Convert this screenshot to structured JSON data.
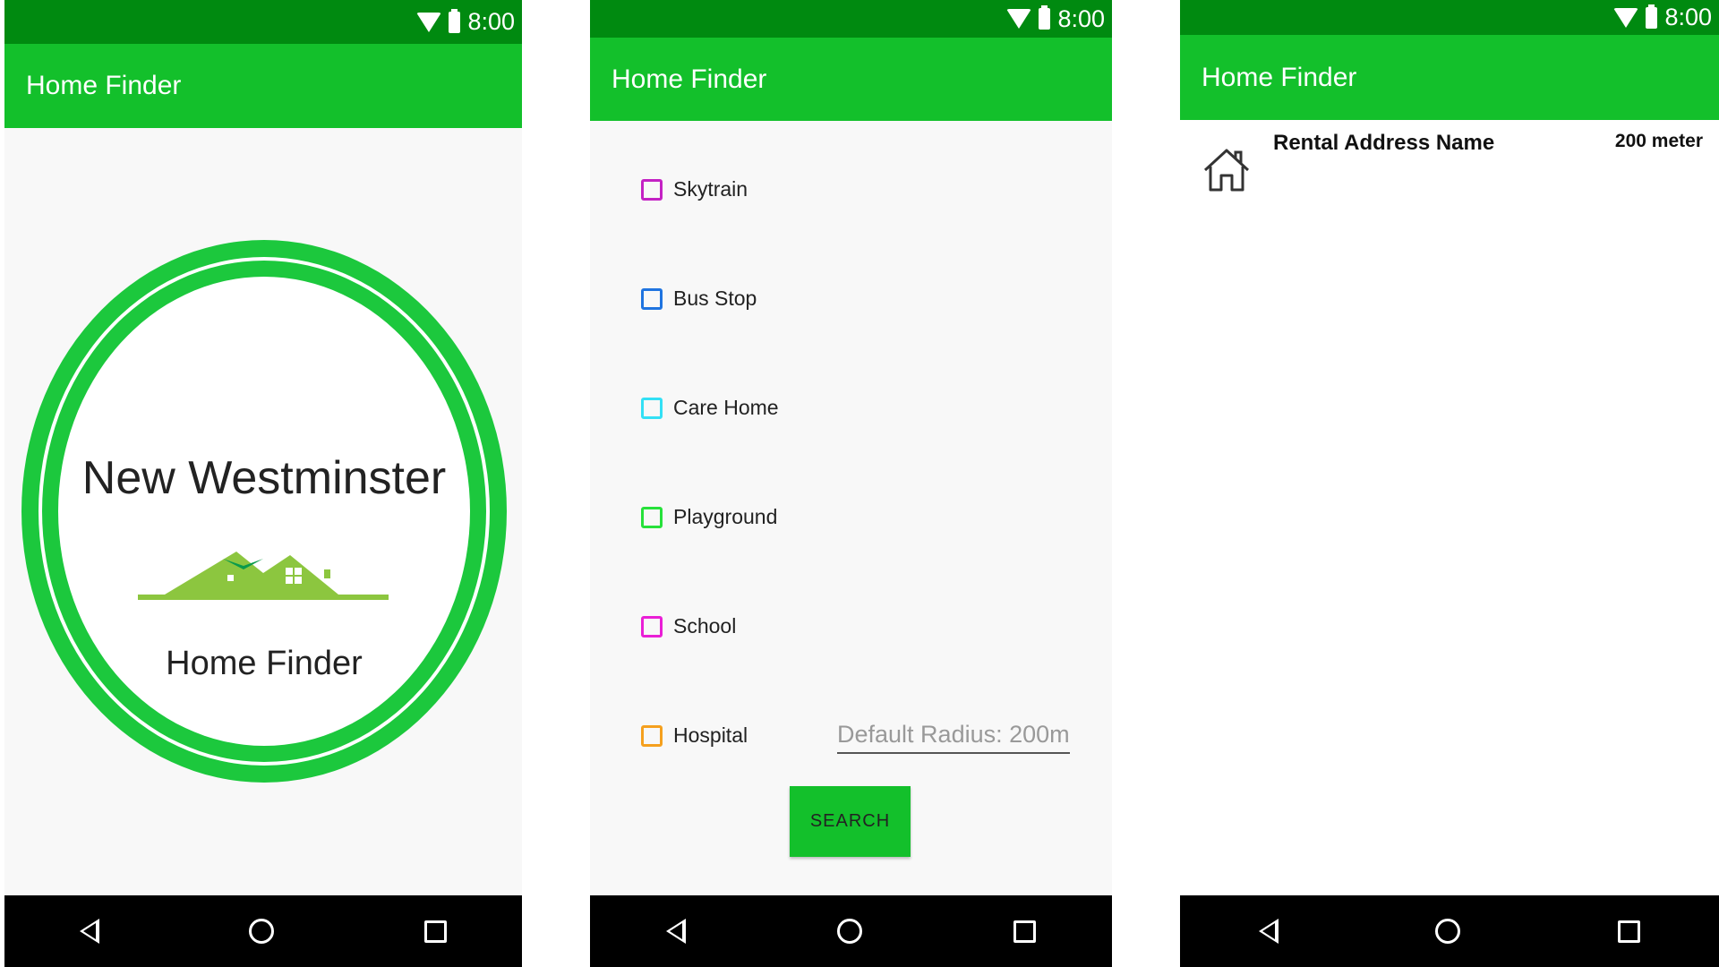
{
  "status": {
    "time": "8:00"
  },
  "app": {
    "title": "Home Finder"
  },
  "splash": {
    "logo_line1": "New Westminster",
    "logo_line2": "Home Finder"
  },
  "filters": {
    "options": [
      {
        "label": "Skytrain",
        "color": "#c421c4"
      },
      {
        "label": "Bus Stop",
        "color": "#1f74e0"
      },
      {
        "label": "Care Home",
        "color": "#33e0f5"
      },
      {
        "label": "Playground",
        "color": "#27e13b"
      },
      {
        "label": "School",
        "color": "#ea1fd6"
      },
      {
        "label": "Hospital",
        "color": "#f5a01e"
      }
    ],
    "radius_placeholder": "Default Radius: 200m",
    "search_label": "SEARCH"
  },
  "results": {
    "items": [
      {
        "name": "Rental Address Name",
        "distance": "200 meter",
        "icon": "house-icon"
      }
    ]
  },
  "colors": {
    "status_bar": "#008a10",
    "app_bar": "#13c02b",
    "logo_ring": "#1cc83d"
  }
}
